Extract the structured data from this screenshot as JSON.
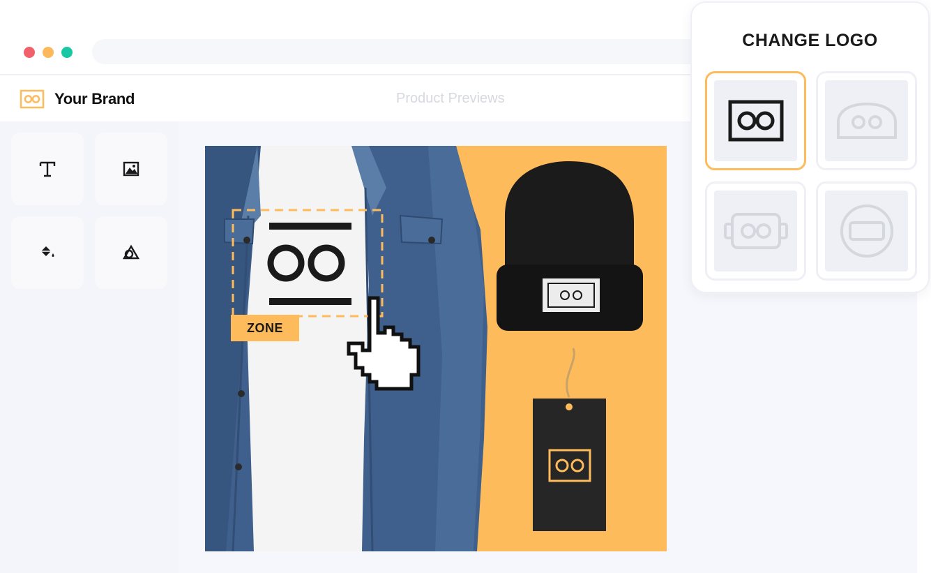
{
  "window": {
    "traffic_lights": [
      "#f2606a",
      "#fbb95c",
      "#19c7a5"
    ]
  },
  "header": {
    "brand_name": "Your Brand",
    "section_title": "Product Previews"
  },
  "toolbar": {
    "tools": [
      {
        "name": "text-tool",
        "icon": "text-icon"
      },
      {
        "name": "image-tool",
        "icon": "image-icon"
      },
      {
        "name": "fill-tool",
        "icon": "paint-bucket-icon"
      },
      {
        "name": "shape-tool",
        "icon": "shapes-icon"
      }
    ]
  },
  "preview": {
    "zone_label": "ZONE",
    "background_color": "#fdbb5b"
  },
  "logo_panel": {
    "title": "CHANGE LOGO",
    "options": [
      {
        "icon": "rect-logo-icon",
        "selected": true
      },
      {
        "icon": "rounded-logo-icon",
        "selected": false
      },
      {
        "icon": "badge-logo-icon",
        "selected": false
      },
      {
        "icon": "circle-logo-icon",
        "selected": false
      }
    ]
  },
  "colors": {
    "accent": "#fdbb5b",
    "dark": "#1a1a1a"
  }
}
